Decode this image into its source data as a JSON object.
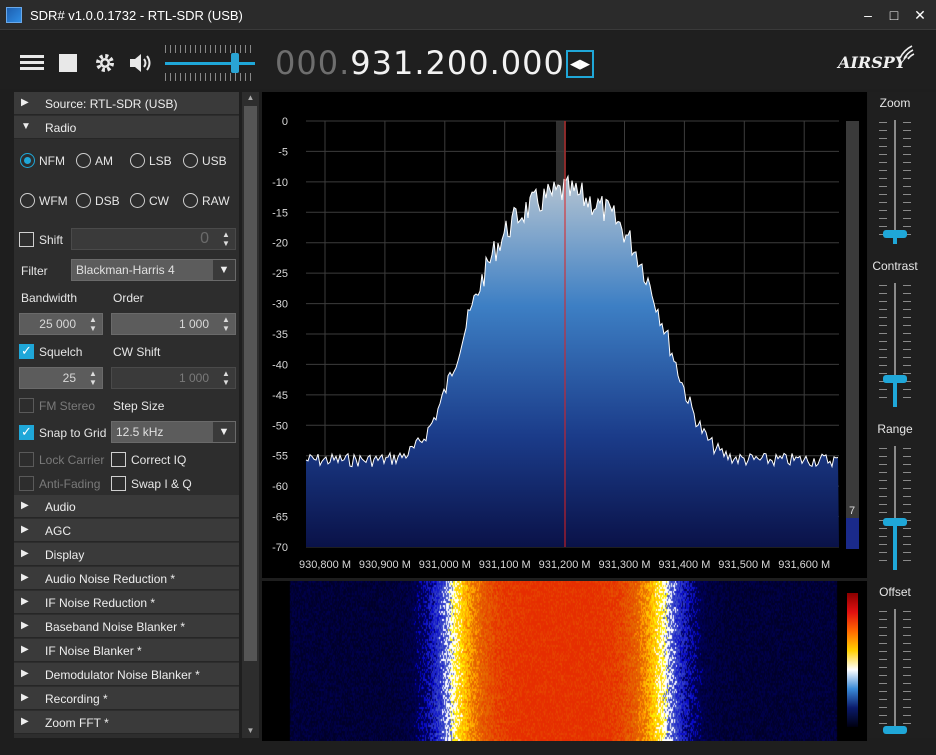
{
  "window": {
    "title": "SDR# v1.0.0.1732 - RTL-SDR (USB)",
    "minimize": "–",
    "maximize": "□",
    "close": "✕"
  },
  "toolbar": {
    "freq_dim": "000.",
    "freq_main": "931.200.000",
    "logo": "AIRSPY",
    "volume_level": 0.82,
    "tune_glyph": "◀▶"
  },
  "left": {
    "source_header": "Source: RTL-SDR (USB)",
    "radio_header": "Radio",
    "modes": [
      "NFM",
      "AM",
      "LSB",
      "USB",
      "WFM",
      "DSB",
      "CW",
      "RAW"
    ],
    "selected_mode": "NFM",
    "shift_label": "Shift",
    "shift_value": "0",
    "filter_label": "Filter",
    "filter_value": "Blackman-Harris 4",
    "bandwidth_label": "Bandwidth",
    "order_label": "Order",
    "bandwidth_value": "25 000",
    "order_value": "1 000",
    "squelch_label": "Squelch",
    "cw_shift_label": "CW Shift",
    "squelch_value": "25",
    "cw_shift_value": "1 000",
    "fm_stereo_label": "FM Stereo",
    "step_size_label": "Step Size",
    "snap_label": "Snap to Grid",
    "step_value": "12.5 kHz",
    "lock_carrier_label": "Lock Carrier",
    "correct_iq_label": "Correct IQ",
    "anti_fading_label": "Anti-Fading",
    "swap_iq_label": "Swap I & Q",
    "sections": [
      "Audio",
      "AGC",
      "Display",
      "Audio Noise Reduction *",
      "IF Noise Reduction *",
      "Baseband Noise Blanker *",
      "IF Noise Blanker *",
      "Demodulator Noise Blanker *",
      "Recording *",
      "Zoom FFT *"
    ]
  },
  "spectrum": {
    "y_ticks": [
      "0",
      "-5",
      "-10",
      "-15",
      "-20",
      "-25",
      "-30",
      "-35",
      "-40",
      "-45",
      "-50",
      "-55",
      "-60",
      "-65",
      "-70"
    ],
    "x_ticks": [
      "930,800 M",
      "930,900 M",
      "931,000 M",
      "931,100 M",
      "931,200 M",
      "931,300 M",
      "931,400 M",
      "931,500 M",
      "931,600 M"
    ],
    "meter_value": "7",
    "colors": {
      "trace": "#ffffff",
      "tuned_line": "#e02020",
      "fill_top": "#a8b8c8",
      "fill_bottom": "#0a1550"
    }
  },
  "right": {
    "zoom_label": "Zoom",
    "contrast_label": "Contrast",
    "range_label": "Range",
    "offset_label": "Offset"
  }
}
